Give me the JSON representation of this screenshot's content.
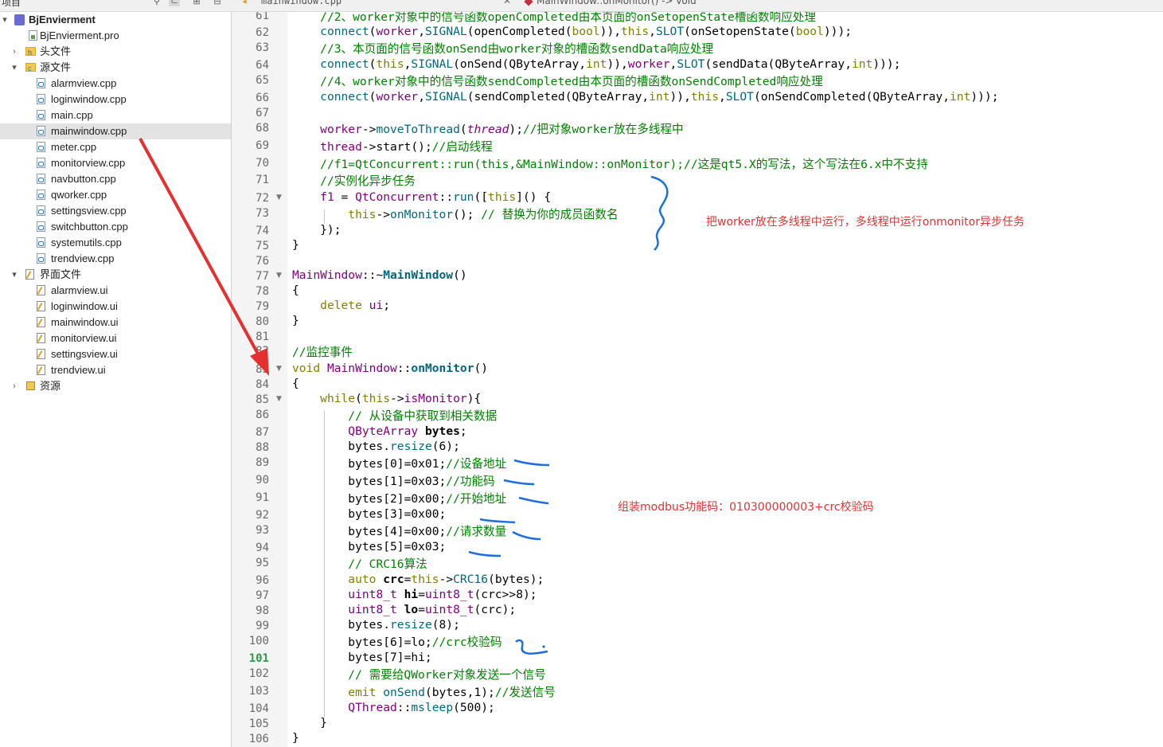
{
  "topbar": {
    "project_label": "项目",
    "file_tab": "mainwindow.cpp",
    "function_tab": "MainWindow::onMonitor() -> void"
  },
  "sidebar": {
    "root": "BjEnvierment",
    "items": [
      {
        "label": "BjEnvierment.pro",
        "type": "pro"
      },
      {
        "label": "头文件",
        "type": "folder-h"
      },
      {
        "label": "源文件",
        "type": "folder-c"
      },
      {
        "label": "alarmview.cpp",
        "type": "cpp"
      },
      {
        "label": "loginwindow.cpp",
        "type": "cpp"
      },
      {
        "label": "main.cpp",
        "type": "cpp"
      },
      {
        "label": "mainwindow.cpp",
        "type": "cpp",
        "selected": true
      },
      {
        "label": "meter.cpp",
        "type": "cpp"
      },
      {
        "label": "monitorview.cpp",
        "type": "cpp"
      },
      {
        "label": "navbutton.cpp",
        "type": "cpp"
      },
      {
        "label": "qworker.cpp",
        "type": "cpp"
      },
      {
        "label": "settingsview.cpp",
        "type": "cpp"
      },
      {
        "label": "switchbutton.cpp",
        "type": "cpp"
      },
      {
        "label": "systemutils.cpp",
        "type": "cpp"
      },
      {
        "label": "trendview.cpp",
        "type": "cpp"
      },
      {
        "label": "界面文件",
        "type": "folder-ui"
      },
      {
        "label": "alarmview.ui",
        "type": "ui"
      },
      {
        "label": "loginwindow.ui",
        "type": "ui"
      },
      {
        "label": "mainwindow.ui",
        "type": "ui"
      },
      {
        "label": "monitorview.ui",
        "type": "ui"
      },
      {
        "label": "settingsview.ui",
        "type": "ui"
      },
      {
        "label": "trendview.ui",
        "type": "ui"
      },
      {
        "label": "资源",
        "type": "folder-res"
      }
    ]
  },
  "editor": {
    "current_line": 101,
    "line_numbers": [
      "61",
      "62",
      "63",
      "64",
      "65",
      "66",
      "67",
      "68",
      "69",
      "70",
      "71",
      "72",
      "73",
      "74",
      "75",
      "76",
      "77",
      "78",
      "79",
      "80",
      "81",
      "82",
      "83",
      "84",
      "85",
      "86",
      "87",
      "88",
      "89",
      "90",
      "91",
      "92",
      "93",
      "94",
      "95",
      "96",
      "97",
      "98",
      "99",
      "100",
      "101",
      "102",
      "103",
      "104",
      "105",
      "106"
    ]
  },
  "annotations": {
    "note1": "把worker放在多线程中运行，多线程中运行onmonitor异步任务",
    "note2": "组装modbus功能码：010300000003+crc校验码"
  },
  "colors": {
    "keyword": "#808000",
    "macro": "#00677c",
    "comment": "#008000",
    "type": "#800080",
    "annotation_red": "#e53030",
    "annotation_blue": "#1e6fd9"
  }
}
